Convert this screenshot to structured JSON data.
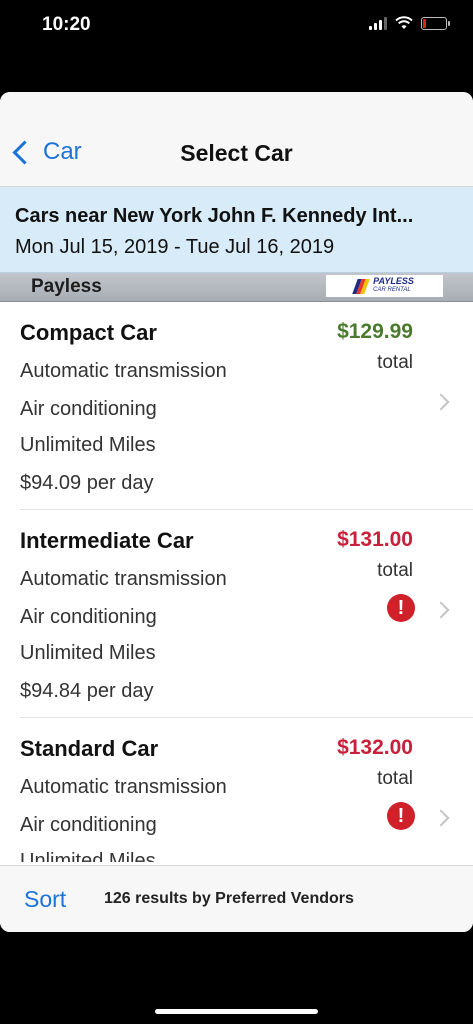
{
  "status": {
    "time": "10:20"
  },
  "nav": {
    "back_label": "Car",
    "title": "Select Car"
  },
  "location": {
    "title": "Cars near New York John F. Kennedy Int...",
    "dates": "Mon Jul 15, 2019 - Tue Jul 16, 2019"
  },
  "vendor": {
    "name": "Payless",
    "logo_text": "PAYLESS",
    "logo_sub": "CAR RENTAL"
  },
  "colors": {
    "accent": "#1a73d9",
    "price_green": "#4a7a2c",
    "price_red": "#c8203a",
    "banner": "#d7ebf8"
  },
  "cars": [
    {
      "name": "Compact Car",
      "price": "$129.99",
      "price_color": "#4a7a2c",
      "total": "total",
      "alert": false,
      "features": [
        "Automatic transmission",
        "Air conditioning",
        "Unlimited Miles",
        "$94.09 per day"
      ]
    },
    {
      "name": "Intermediate Car",
      "price": "$131.00",
      "price_color": "#c8203a",
      "total": "total",
      "alert": true,
      "features": [
        "Automatic transmission",
        "Air conditioning",
        "Unlimited Miles",
        "$94.84 per day"
      ]
    },
    {
      "name": "Standard Car",
      "price": "$132.00",
      "price_color": "#c8203a",
      "total": "total",
      "alert": true,
      "features": [
        "Automatic transmission",
        "Air conditioning",
        "Unlimited Miles"
      ]
    }
  ],
  "alert_icon": "exclamation-circle-icon",
  "bottom": {
    "sort_label": "Sort",
    "results": "126 results by Preferred Vendors"
  }
}
